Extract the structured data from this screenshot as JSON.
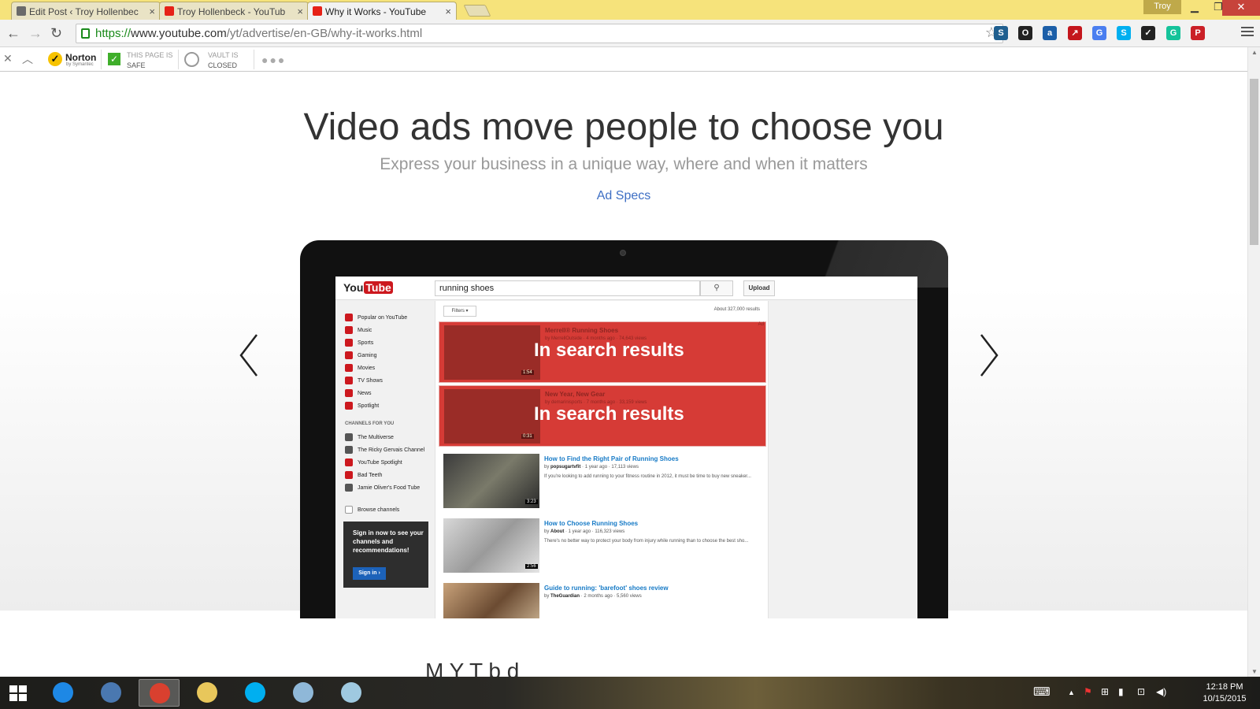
{
  "browser": {
    "tabs": [
      {
        "title": "Edit Post ‹ Troy Hollenbec",
        "active": false,
        "favicon": "wordpress-icon"
      },
      {
        "title": "Troy Hollenbeck - YouTub",
        "active": false,
        "favicon": "youtube-icon"
      },
      {
        "title": "Why it Works - YouTube",
        "active": true,
        "favicon": "youtube-icon"
      }
    ],
    "tab_close": "×",
    "user": "Troy",
    "url": {
      "scheme": "https://",
      "host": "www.youtube.com",
      "path": "/yt/advertise/en-GB/why-it-works.html"
    },
    "extensions": [
      {
        "name": "s-extension-icon",
        "label": "S",
        "color": "#1f5f8f"
      },
      {
        "name": "owl-extension-icon",
        "label": "O",
        "color": "#222222"
      },
      {
        "name": "at-extension-icon",
        "label": "a",
        "color": "#1c5fa8"
      },
      {
        "name": "arrow-extension-icon",
        "label": "↗",
        "color": "#c4161c"
      },
      {
        "name": "translate-extension-icon",
        "label": "G",
        "color": "#4a7ef0"
      },
      {
        "name": "skype-extension-icon",
        "label": "S",
        "color": "#00aff0"
      },
      {
        "name": "norton-extension-icon",
        "label": "✓",
        "color": "#222222"
      },
      {
        "name": "grammarly-extension-icon",
        "label": "G",
        "color": "#15c39a"
      },
      {
        "name": "pinterest-extension-icon",
        "label": "P",
        "color": "#cb2027"
      }
    ]
  },
  "norton_bar": {
    "brand": "Norton",
    "brand_sub": "by Symantec",
    "page_status_line1": "THIS PAGE IS",
    "page_status_line2": "SAFE",
    "vault_line1": "VAULT IS",
    "vault_line2": "CLOSED"
  },
  "page": {
    "headline": "Video ads move people to choose you",
    "subheadline": "Express your business in a unique way, where and when it matters",
    "ad_specs_link": "Ad Specs",
    "bottom_partial": "M                                         Y  T  b                    d"
  },
  "mock_youtube": {
    "logo_you": "You",
    "logo_tube": "Tube",
    "search_query": "running shoes",
    "upload": "Upload",
    "filters": "Filters ▾",
    "result_count": "About 327,000 results",
    "sidebar": [
      {
        "label": "Popular on YouTube"
      },
      {
        "label": "Music"
      },
      {
        "label": "Sports"
      },
      {
        "label": "Gaming"
      },
      {
        "label": "Movies"
      },
      {
        "label": "TV Shows"
      },
      {
        "label": "News"
      },
      {
        "label": "Spotlight"
      }
    ],
    "channels_heading": "CHANNELS FOR YOU",
    "channels": [
      {
        "label": "The Multiverse"
      },
      {
        "label": "The Ricky Gervais Channel"
      },
      {
        "label": "YouTube Spotlight"
      },
      {
        "label": "Bad Teeth"
      },
      {
        "label": "Jamie Oliver's Food Tube"
      }
    ],
    "browse_channels": "Browse channels",
    "signin_prompt": "Sign in now to see your channels and recommendations!",
    "signin_button": "Sign in ›",
    "highlighted_results": [
      {
        "title": "Merrell® Running Shoes",
        "by": "by MerrellOutside · 4 months ago · 74,643 views",
        "duration": "1:54",
        "overlay": "In search results",
        "ad_badge": "Ad"
      },
      {
        "title": "New Year, New Gear",
        "by": "by demarinisports · 7 months ago · 33,159 views",
        "duration": "0:31",
        "overlay": "In search results",
        "ad_badge": ""
      }
    ],
    "results": [
      {
        "title": "How to Find the Right Pair of Running Shoes",
        "channel": "popsugartvfit",
        "meta": " · 1 year ago · 17,113 views",
        "desc": "If you're looking to add running to your fitness routine in 2012, it must be time to buy new sneaker...",
        "duration": "3:23"
      },
      {
        "title": "How to Choose Running Shoes",
        "channel": "About",
        "meta": " · 1 year ago · 116,323 views",
        "desc": "There's no better way to protect your body from injury while running than to choose the best sho...",
        "duration": "2:56"
      },
      {
        "title": "Guide to running: 'barefoot' shoes review",
        "channel": "TheGuardian",
        "meta": " · 2 months ago · 5,560 views",
        "desc": "",
        "duration": ""
      }
    ]
  },
  "taskbar": {
    "apps": [
      {
        "name": "internet-explorer-icon",
        "color": "#1e88e5"
      },
      {
        "name": "thunderbird-icon",
        "color": "#4a78b0"
      },
      {
        "name": "chrome-icon",
        "color": "#d9402f"
      },
      {
        "name": "file-explorer-icon",
        "color": "#e8c75b"
      },
      {
        "name": "skype-icon",
        "color": "#00aff0"
      },
      {
        "name": "paint-icon",
        "color": "#8fb8d8"
      },
      {
        "name": "notes-icon",
        "color": "#9fc9e0"
      }
    ],
    "active_app": "chrome-icon",
    "time": "12:18 PM",
    "date": "10/15/2015"
  },
  "colors": {
    "youtube_red": "#cc181e",
    "highlight_red": "#d63b36",
    "link_blue": "#3e6fc4",
    "tab_strip": "#f6e37b"
  }
}
